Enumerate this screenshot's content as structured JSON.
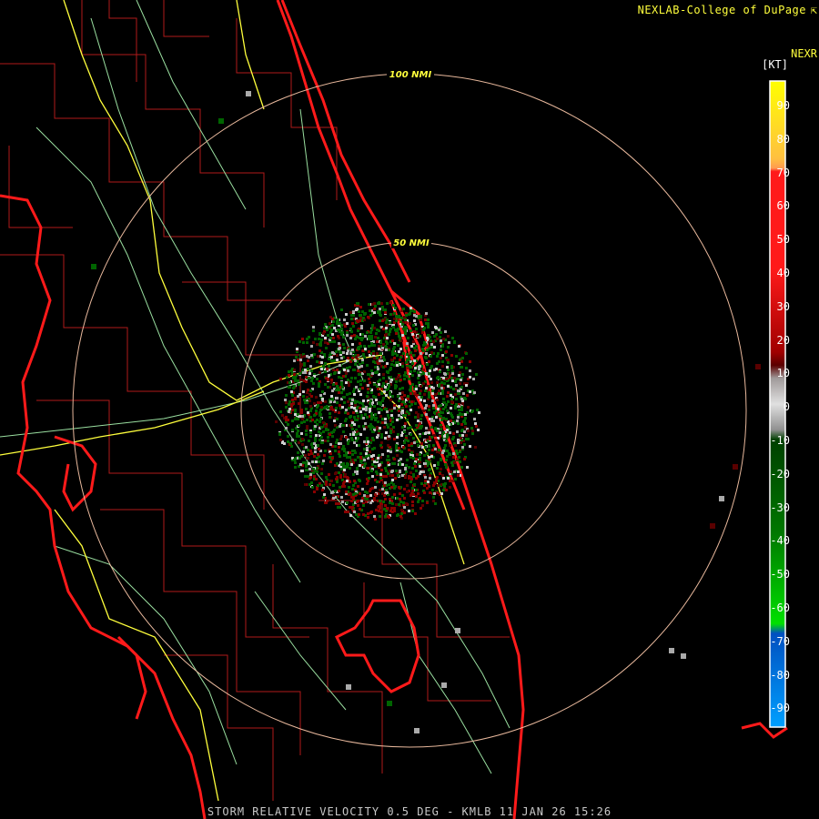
{
  "header": {
    "credit": "NEXLAB-College of DuPage",
    "credit_icon": "arrow-box-icon",
    "product_code": "NEXR",
    "unit": "[KT]"
  },
  "rings": [
    {
      "label": "100 NMI"
    },
    {
      "label": "50 NMI"
    }
  ],
  "legend": {
    "ticks": [
      "90",
      "80",
      "70",
      "60",
      "50",
      "40",
      "30",
      "20",
      "10",
      "0",
      "-10",
      "-20",
      "-30",
      "-40",
      "-50",
      "-60",
      "-70",
      "-80",
      "-90"
    ],
    "colors": {
      "yellow": "#ffff00",
      "orange": "#ff9a50",
      "red": "#ff1a1a",
      "dark_red": "#5a0000",
      "gray": "#aaaaaa",
      "green": "#006400",
      "bright_green": "#00e000",
      "blue": "#0050c0",
      "light_blue": "#00a0ff"
    }
  },
  "footer": {
    "text": "STORM RELATIVE VELOCITY 0.5 DEG - KMLB 11 JAN 26 15:26"
  }
}
